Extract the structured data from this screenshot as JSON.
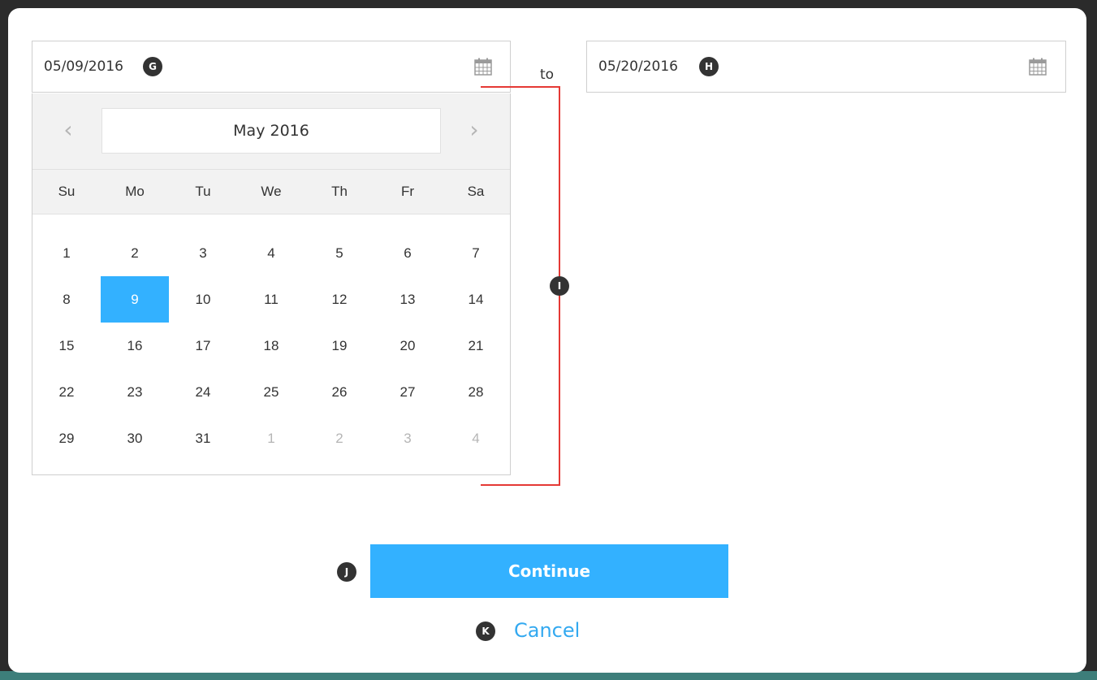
{
  "start_date": {
    "value": "05/09/2016",
    "marker": "G",
    "icon": "calendar-icon"
  },
  "separator": "to",
  "end_date": {
    "value": "05/20/2016",
    "marker": "H",
    "icon": "calendar-icon"
  },
  "calendar": {
    "month_label": "May 2016",
    "prev_icon": "chevron-left-icon",
    "next_icon": "chevron-right-icon",
    "weekdays": [
      "Su",
      "Mo",
      "Tu",
      "We",
      "Th",
      "Fr",
      "Sa"
    ],
    "days": [
      {
        "label": "1",
        "current": true
      },
      {
        "label": "2",
        "current": true
      },
      {
        "label": "3",
        "current": true
      },
      {
        "label": "4",
        "current": true
      },
      {
        "label": "5",
        "current": true
      },
      {
        "label": "6",
        "current": true
      },
      {
        "label": "7",
        "current": true
      },
      {
        "label": "8",
        "current": true
      },
      {
        "label": "9",
        "current": true,
        "selected": true
      },
      {
        "label": "10",
        "current": true
      },
      {
        "label": "11",
        "current": true
      },
      {
        "label": "12",
        "current": true
      },
      {
        "label": "13",
        "current": true
      },
      {
        "label": "14",
        "current": true
      },
      {
        "label": "15",
        "current": true
      },
      {
        "label": "16",
        "current": true
      },
      {
        "label": "17",
        "current": true
      },
      {
        "label": "18",
        "current": true
      },
      {
        "label": "19",
        "current": true
      },
      {
        "label": "20",
        "current": true
      },
      {
        "label": "21",
        "current": true
      },
      {
        "label": "22",
        "current": true
      },
      {
        "label": "23",
        "current": true
      },
      {
        "label": "24",
        "current": true
      },
      {
        "label": "25",
        "current": true
      },
      {
        "label": "26",
        "current": true
      },
      {
        "label": "27",
        "current": true
      },
      {
        "label": "28",
        "current": true
      },
      {
        "label": "29",
        "current": true
      },
      {
        "label": "30",
        "current": true
      },
      {
        "label": "31",
        "current": true
      },
      {
        "label": "1",
        "current": false
      },
      {
        "label": "2",
        "current": false
      },
      {
        "label": "3",
        "current": false
      },
      {
        "label": "4",
        "current": false
      }
    ],
    "marker": "I"
  },
  "actions": {
    "continue_label": "Continue",
    "continue_marker": "J",
    "cancel_label": "Cancel",
    "cancel_marker": "K"
  },
  "colors": {
    "accent": "#33b1ff",
    "annotation_line": "#e53935",
    "marker_bg": "#333333"
  }
}
